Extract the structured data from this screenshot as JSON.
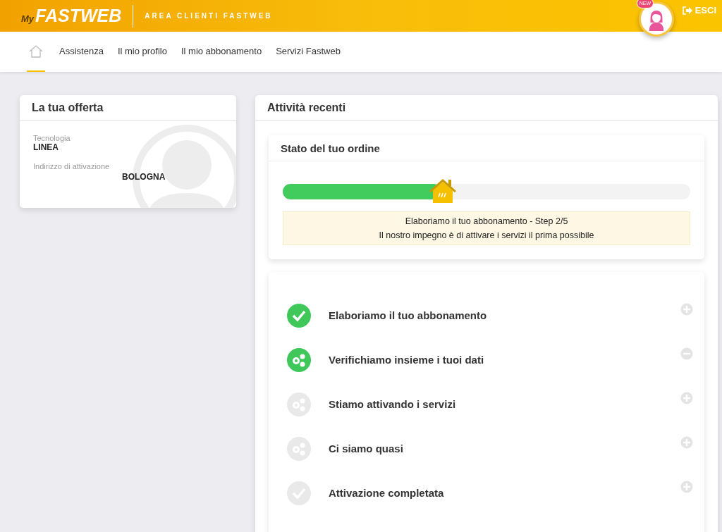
{
  "header": {
    "logo_prefix": "My",
    "logo": "FASTWEB",
    "subtitle": "AREA CLIENTI FASTWEB",
    "avatar_badge": "NEW",
    "logout": "ESCI"
  },
  "nav": [
    {
      "label": "Assistenza",
      "selected": false
    },
    {
      "label": "Il mio profilo",
      "selected": false
    },
    {
      "label": "Il mio abbonamento",
      "selected": false
    },
    {
      "label": "Servizi Fastweb",
      "selected": false
    }
  ],
  "home_selected": true,
  "offer": {
    "title": "La tua offerta",
    "fields": [
      {
        "label": "Tecnologia",
        "value": "LINEA"
      },
      {
        "label": "Indirizzo di attivazione",
        "value": "BOLOGNA"
      }
    ]
  },
  "activity": {
    "title": "Attività recenti",
    "order": {
      "title": "Stato del tuo ordine",
      "progress": {
        "level": 0.39
      },
      "message": "Elaboriamo il tuo abbonamento - Step 2/5",
      "note": "Il nostro impegno è di attivare i servizi il prima possibile"
    },
    "steps": [
      {
        "kind": "check",
        "label": "Elaboriamo il tuo abbonamento",
        "done": true,
        "expanded": false
      },
      {
        "kind": "gears",
        "label": "Verifichiamo insieme i tuoi dati",
        "done": true,
        "expanded": true
      },
      {
        "kind": "gears",
        "label": "Stiamo attivando i servizi",
        "done": false,
        "expanded": false
      },
      {
        "kind": "gears",
        "label": "Ci siamo quasi",
        "done": false,
        "expanded": false
      },
      {
        "kind": "check",
        "label": "Attivazione completata",
        "done": false,
        "expanded": false
      }
    ]
  }
}
